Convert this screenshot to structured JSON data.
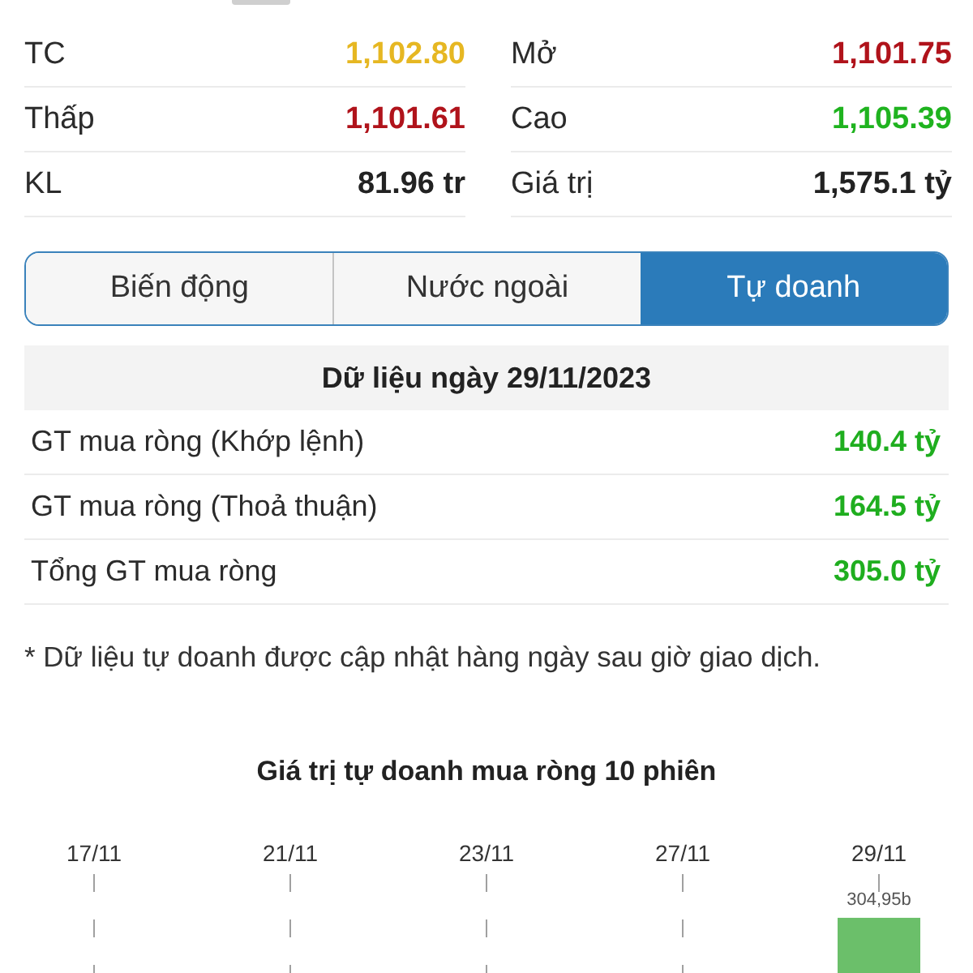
{
  "stats": [
    {
      "label": "TC",
      "value": "1,102.80",
      "color": "#e6b722"
    },
    {
      "label": "Mở",
      "value": "1,101.75",
      "color": "#b0131b"
    },
    {
      "label": "Thấp",
      "value": "1,101.61",
      "color": "#b0131b"
    },
    {
      "label": "Cao",
      "value": "1,105.39",
      "color": "#1fb31f"
    },
    {
      "label": "KL",
      "value": "81.96 tr",
      "color": "#222222"
    },
    {
      "label": "Giá trị",
      "value": "1,575.1 tỷ",
      "color": "#222222"
    }
  ],
  "tabs": [
    {
      "label": "Biến động",
      "selected": false
    },
    {
      "label": "Nước ngoài",
      "selected": false
    },
    {
      "label": "Tự doanh",
      "selected": true
    }
  ],
  "net_buy": {
    "header": "Dữ liệu ngày 29/11/2023",
    "rows": [
      {
        "label": "GT mua ròng (Khớp lệnh)",
        "value": "140.4 tỷ"
      },
      {
        "label": "GT mua ròng (Thoả thuận)",
        "value": "164.5 tỷ"
      },
      {
        "label": "Tổng GT mua ròng",
        "value": "305.0 tỷ"
      }
    ]
  },
  "footnote": "* Dữ liệu tự doanh được cập nhật hàng ngày sau giờ giao dịch.",
  "chart": {
    "chart_data": {
      "type": "bar",
      "title": "Giá trị tự doanh mua ròng 10 phiên",
      "categories": [
        "17/11",
        "21/11",
        "23/11",
        "27/11",
        "29/11"
      ],
      "values": [
        null,
        null,
        null,
        null,
        304.95
      ],
      "value_labels": [
        null,
        null,
        null,
        null,
        "304,95b"
      ],
      "grid": true
    }
  }
}
